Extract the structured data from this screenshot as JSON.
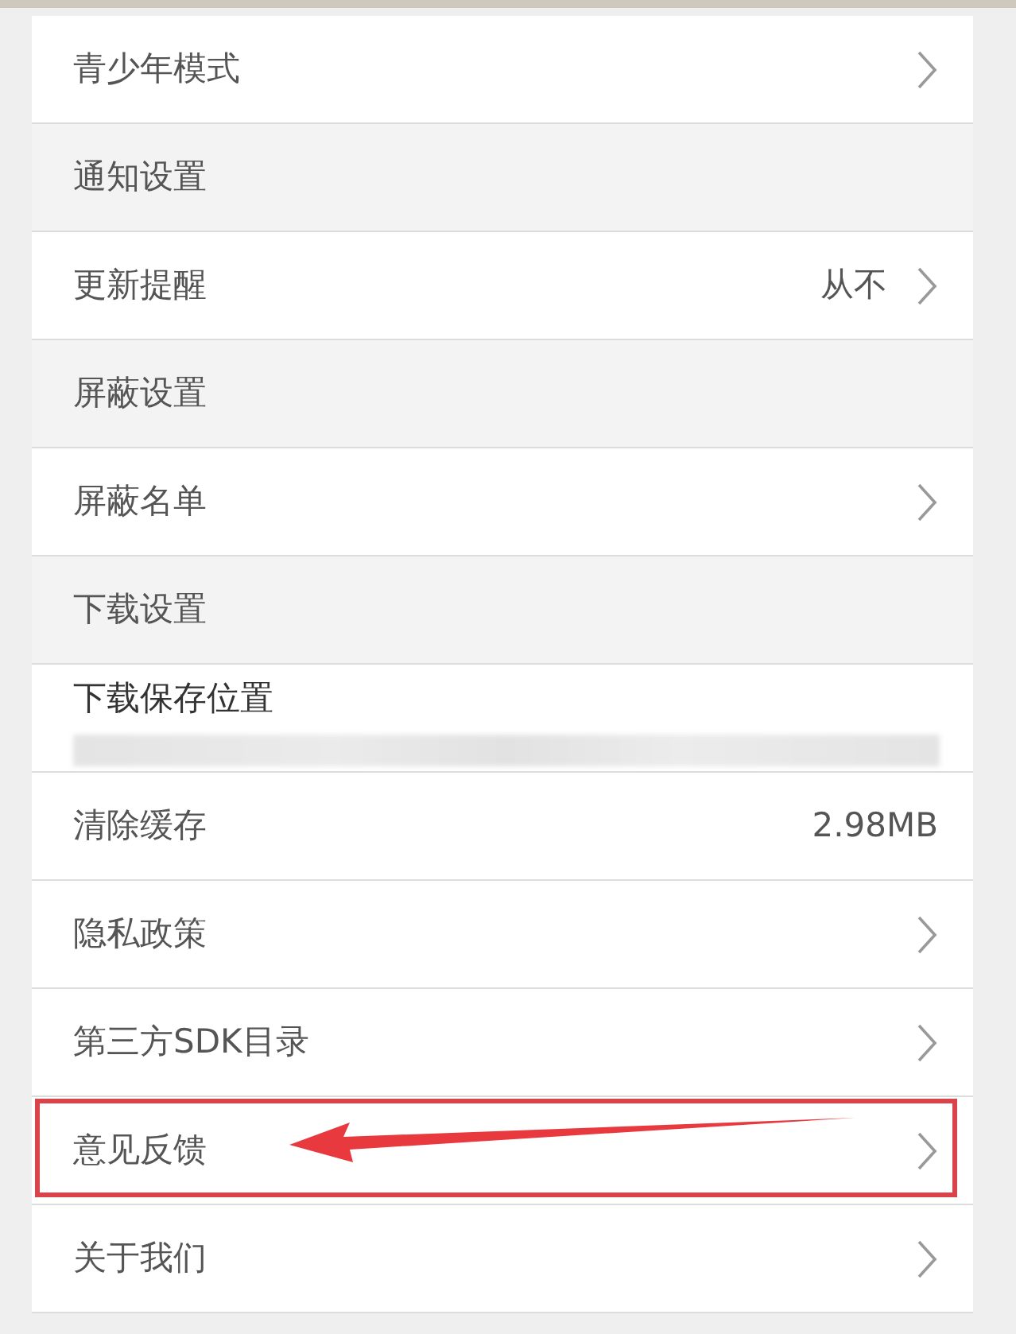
{
  "items": [
    {
      "kind": "link",
      "label": "青少年模式"
    },
    {
      "kind": "header",
      "label": "通知设置"
    },
    {
      "kind": "link",
      "label": "更新提醒",
      "value": "从不"
    },
    {
      "kind": "header",
      "label": "屏蔽设置"
    },
    {
      "kind": "link",
      "label": "屏蔽名单"
    },
    {
      "kind": "header",
      "label": "下载设置"
    },
    {
      "kind": "path",
      "label": "下载保存位置",
      "redacted": true
    },
    {
      "kind": "value",
      "label": "清除缓存",
      "value": "2.98MB"
    },
    {
      "kind": "link",
      "label": "隐私政策"
    },
    {
      "kind": "link",
      "label": "第三方SDK目录"
    },
    {
      "kind": "link",
      "label": "意见反馈",
      "highlighted": true
    },
    {
      "kind": "link",
      "label": "关于我们"
    }
  ]
}
